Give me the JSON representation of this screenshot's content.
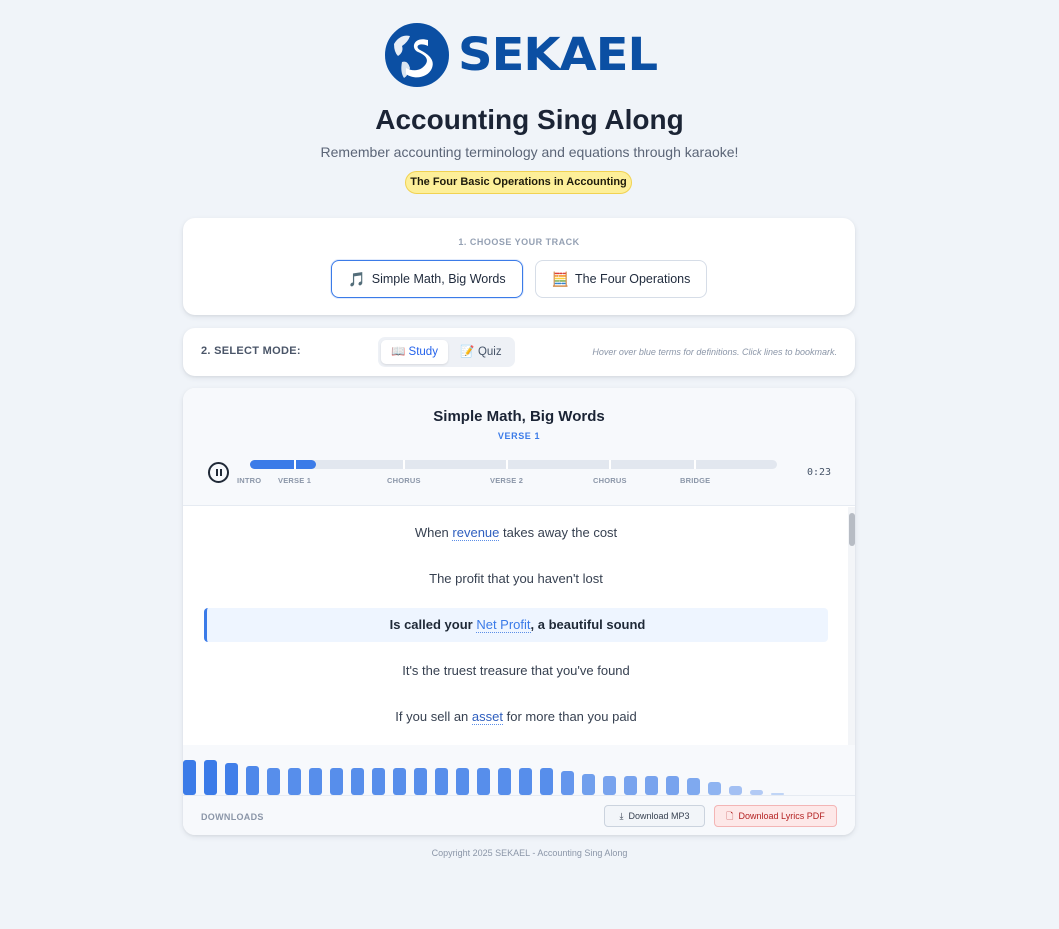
{
  "brand": {
    "name": "SEKAEL",
    "accent": "#0b4fa3"
  },
  "header": {
    "title": "Accounting Sing Along",
    "subtitle": "Remember accounting terminology and equations through karaoke!",
    "topic_badge": "The Four Basic Operations in Accounting"
  },
  "track_section": {
    "label": "1. CHOOSE YOUR TRACK",
    "tracks": [
      {
        "label": "Simple Math, Big Words",
        "icon": "music-note-icon",
        "selected": true
      },
      {
        "label": "The Four Operations",
        "icon": "calculator-icon",
        "selected": false
      }
    ]
  },
  "mode_section": {
    "label": "2. SELECT MODE:",
    "modes": [
      {
        "label": "Study",
        "icon": "book-icon",
        "selected": true
      },
      {
        "label": "Quiz",
        "icon": "memo-icon",
        "selected": false
      }
    ],
    "hint": "Hover over blue terms for definitions. Click lines to bookmark."
  },
  "player": {
    "song_title": "Simple Math, Big Words",
    "current_section": "VERSE 1",
    "time": "0:23",
    "progress": 0.125,
    "state": "playing",
    "sections": [
      "INTRO",
      "VERSE 1",
      "CHORUS",
      "VERSE 2",
      "CHORUS",
      "BRIDGE"
    ],
    "lyrics": [
      {
        "before": "When ",
        "term": "revenue",
        "after": " takes away the cost",
        "current": false
      },
      {
        "before": "The profit that you haven't lost",
        "term": "",
        "after": "",
        "current": false
      },
      {
        "before": "Is called your ",
        "term": "Net Profit",
        "after": ", a beautiful sound",
        "current": true
      },
      {
        "before": "It's the truest treasure that you've found",
        "term": "",
        "after": "",
        "current": false
      },
      {
        "before": "If you sell an ",
        "term": "asset",
        "after": " for more than you paid",
        "current": false
      }
    ],
    "visualizer_levels": [
      1.0,
      1.0,
      0.92,
      0.83,
      0.76,
      0.76,
      0.76,
      0.76,
      0.76,
      0.76,
      0.76,
      0.76,
      0.76,
      0.76,
      0.76,
      0.76,
      0.76,
      0.76,
      0.68,
      0.6,
      0.54,
      0.54,
      0.54,
      0.54,
      0.5,
      0.38,
      0.26,
      0.15,
      0.05
    ]
  },
  "downloads": {
    "label": "DOWNLOADS",
    "mp3_label": "Download MP3",
    "pdf_label": "Download Lyrics PDF"
  },
  "footer": {
    "text": "Copyright 2025 SEKAEL - Accounting Sing Along"
  }
}
